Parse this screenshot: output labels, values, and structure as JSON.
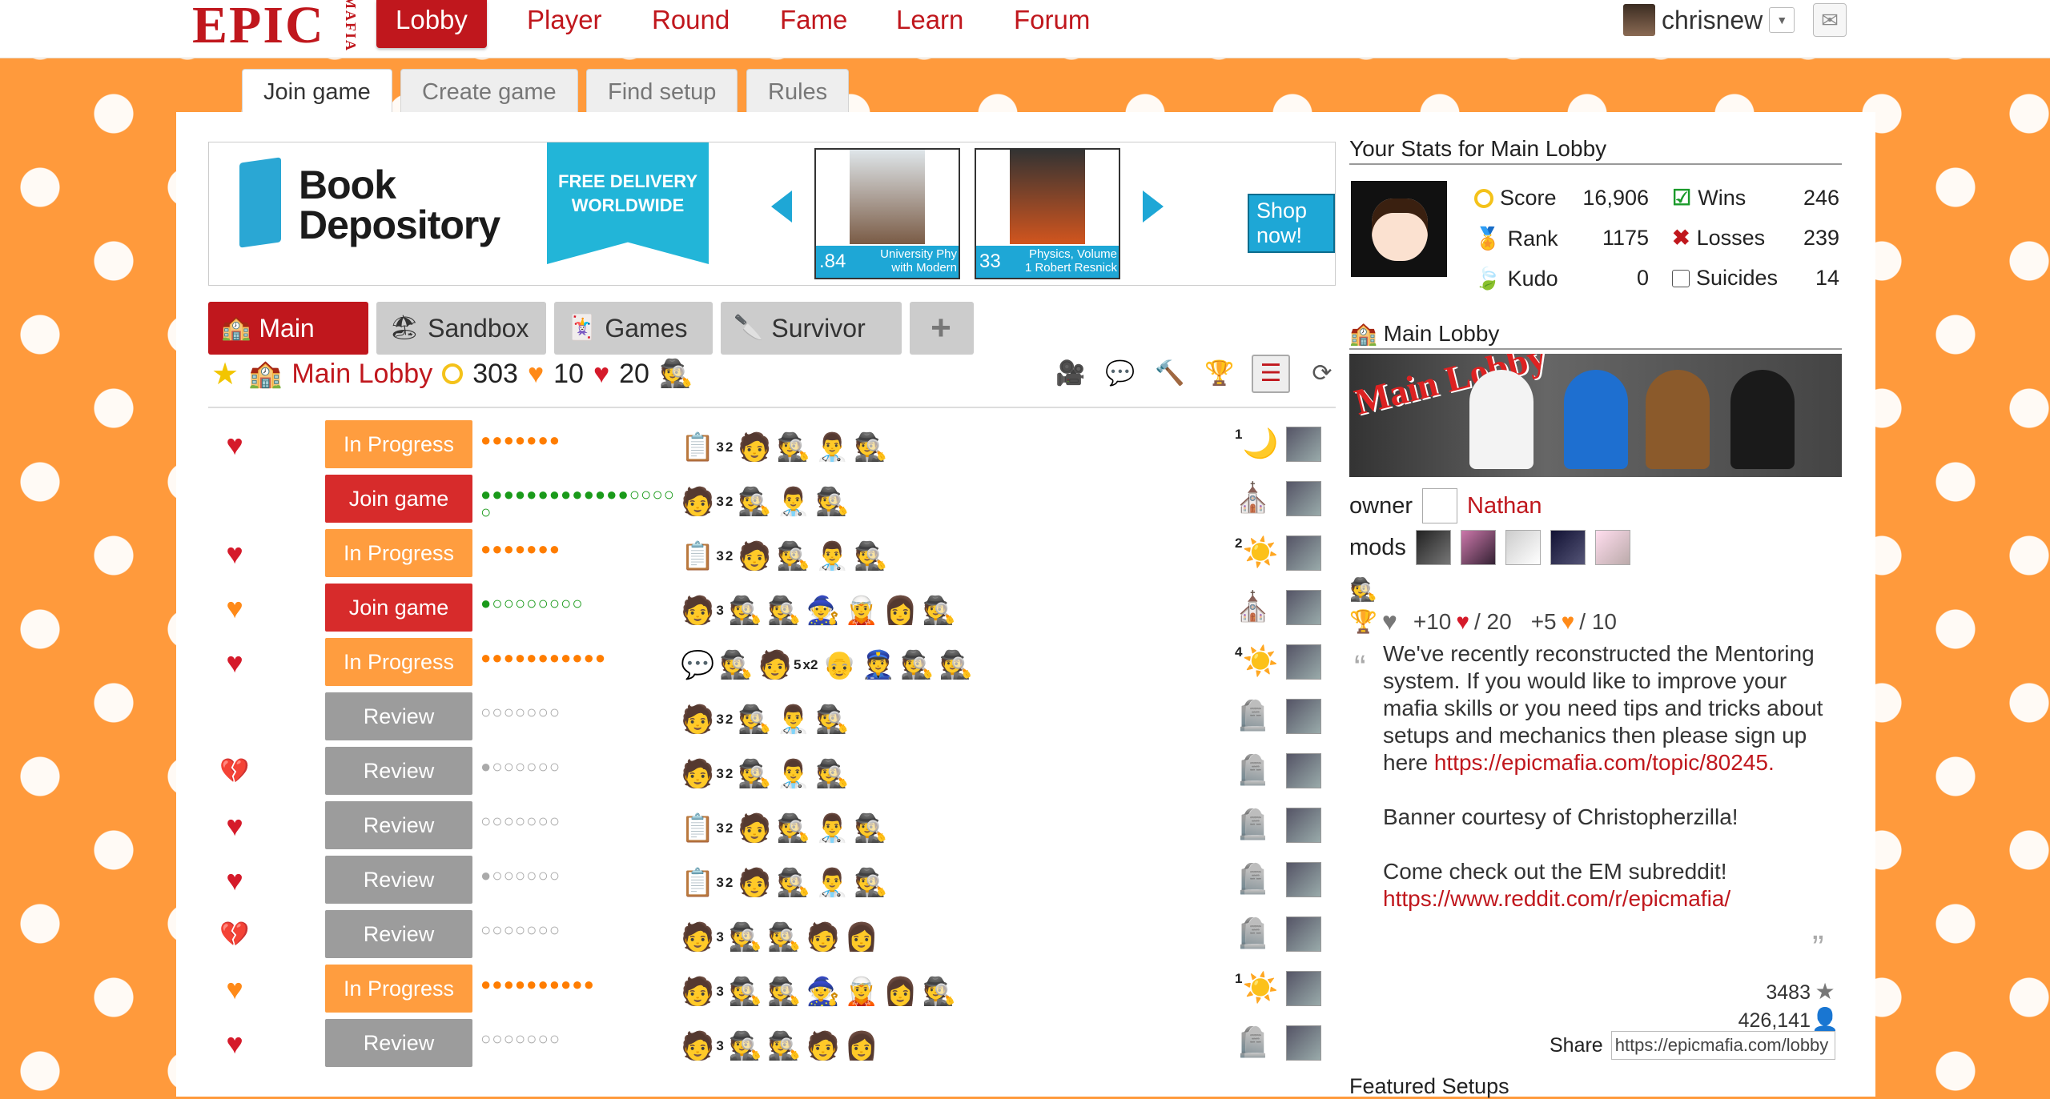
{
  "nav": {
    "logo": "EPIC",
    "logo_small": "MAFIA",
    "links": [
      "Lobby",
      "Player",
      "Round",
      "Fame",
      "Learn",
      "Forum"
    ],
    "username": "chrisnew"
  },
  "subtabs": [
    "Join game",
    "Create game",
    "Find setup",
    "Rules"
  ],
  "ad": {
    "brand_line1": "Book",
    "brand_line2": "Depository",
    "ribbon": "FREE DELIVERY WORLDWIDE",
    "books": [
      {
        "price": ".84",
        "title": "University Phy with Modern"
      },
      {
        "price": "33",
        "title": "Physics, Volume 1 Robert Resnick"
      }
    ],
    "cta": "Shop now!"
  },
  "lobby_tabs": [
    "Main",
    "Sandbox",
    "Games",
    "Survivor",
    "+"
  ],
  "infobar": {
    "lobby_name": "Main Lobby",
    "score": "303",
    "orange_hearts": "10",
    "red_hearts": "20"
  },
  "games": [
    {
      "heart": "red",
      "status": "In Progress",
      "kind": "inprogress",
      "dots": "●●●●●●●",
      "dots_style": "orange",
      "roles": [
        "📋",
        "🧑",
        "🕵️",
        "👨‍⚕️",
        "🕵"
      ],
      "role_counts": [
        "3",
        "2",
        "",
        ""
      ],
      "phase": "🌙",
      "phase_count": "1"
    },
    {
      "heart": "",
      "status": "Join game",
      "kind": "join",
      "dots": "●●●●●●●●●●●●●○○○○○",
      "dots_style": "green",
      "roles": [
        "🧑",
        "🕵️",
        "👨‍⚕️",
        "🕵"
      ],
      "role_counts": [
        "3",
        "2",
        "",
        ""
      ],
      "phase": "⛪",
      "phase_count": ""
    },
    {
      "heart": "red",
      "status": "In Progress",
      "kind": "inprogress",
      "dots": "●●●●●●●",
      "dots_style": "orange",
      "roles": [
        "📋",
        "🧑",
        "🕵️",
        "👨‍⚕️",
        "🕵"
      ],
      "role_counts": [
        "3",
        "2",
        "",
        ""
      ],
      "phase": "☀️",
      "phase_count": "2"
    },
    {
      "heart": "orange",
      "status": "Join game",
      "kind": "join",
      "dots": "●○○○○○○○○",
      "dots_style": "green",
      "roles": [
        "🧑",
        "🕵️",
        "🕵",
        "🧙",
        "🧝",
        "👩",
        "🕵️"
      ],
      "role_counts": [
        "3",
        "",
        "",
        ""
      ],
      "phase": "⛪",
      "phase_count": ""
    },
    {
      "heart": "red",
      "status": "In Progress",
      "kind": "inprogress",
      "dots": "●●●●●●●●●●●",
      "dots_style": "orange",
      "roles": [
        "💬",
        "🕵",
        "🧑",
        "👴",
        "👮",
        "🕵",
        "🕵️"
      ],
      "role_counts": [
        "",
        "",
        "5",
        "x2"
      ],
      "phase": "☀️",
      "phase_count": "4"
    },
    {
      "heart": "",
      "status": "Review",
      "kind": "review",
      "dots": "○○○○○○○",
      "dots_style": "gray",
      "roles": [
        "🧑",
        "🕵️",
        "👨‍⚕️",
        "🕵"
      ],
      "role_counts": [
        "3",
        "2",
        "",
        ""
      ],
      "phase": "🪦",
      "phase_count": ""
    },
    {
      "heart": "broken",
      "status": "Review",
      "kind": "review",
      "dots": "●○○○○○○",
      "dots_style": "gray",
      "roles": [
        "🧑",
        "🕵️",
        "👨‍⚕️",
        "🕵"
      ],
      "role_counts": [
        "3",
        "2",
        "",
        ""
      ],
      "phase": "🪦",
      "phase_count": ""
    },
    {
      "heart": "red",
      "status": "Review",
      "kind": "review",
      "dots": "○○○○○○○",
      "dots_style": "gray",
      "roles": [
        "📋",
        "🧑",
        "🕵️",
        "👨‍⚕️",
        "🕵"
      ],
      "role_counts": [
        "3",
        "2",
        "",
        ""
      ],
      "phase": "🪦",
      "phase_count": ""
    },
    {
      "heart": "red",
      "status": "Review",
      "kind": "review",
      "dots": "●○○○○○○",
      "dots_style": "gray",
      "roles": [
        "📋",
        "🧑",
        "🕵️",
        "👨‍⚕️",
        "🕵"
      ],
      "role_counts": [
        "3",
        "2",
        "",
        ""
      ],
      "phase": "🪦",
      "phase_count": ""
    },
    {
      "heart": "broken",
      "status": "Review",
      "kind": "review",
      "dots": "○○○○○○○",
      "dots_style": "gray",
      "roles": [
        "🧑",
        "🕵️",
        "🕵",
        "🧑",
        "👩"
      ],
      "role_counts": [
        "3",
        "",
        "",
        ""
      ],
      "phase": "🪦",
      "phase_count": ""
    },
    {
      "heart": "orange",
      "status": "In Progress",
      "kind": "inprogress",
      "dots": "●●●●●●●●●●",
      "dots_style": "orange",
      "roles": [
        "🧑",
        "🕵️",
        "🕵",
        "🧙",
        "🧝",
        "👩",
        "🕵️"
      ],
      "role_counts": [
        "3",
        "",
        "",
        ""
      ],
      "phase": "☀️",
      "phase_count": "1"
    },
    {
      "heart": "red",
      "status": "Review",
      "kind": "review",
      "dots": "○○○○○○○",
      "dots_style": "gray",
      "roles": [
        "🧑",
        "🕵️",
        "🕵",
        "🧑",
        "👩"
      ],
      "role_counts": [
        "3",
        "",
        "",
        ""
      ],
      "phase": "🪦",
      "phase_count": ""
    }
  ],
  "stats": {
    "heading": "Your Stats for Main Lobby",
    "score_label": "Score",
    "score": "16,906",
    "rank_label": "Rank",
    "rank": "1175",
    "kudo_label": "Kudo",
    "kudo": "0",
    "wins_label": "Wins",
    "wins": "246",
    "losses_label": "Losses",
    "losses": "239",
    "suicides_label": "Suicides",
    "suicides": "14"
  },
  "lobby_info": {
    "heading": "Main Lobby",
    "banner_text": "Main Lobby",
    "owner_label": "owner",
    "owner": "Nathan",
    "mods_label": "mods",
    "kudos": {
      "red_plus": "+10",
      "red_max": "/ 20",
      "orange_plus": "+5",
      "orange_max": "/ 10"
    },
    "desc": [
      "We've recently reconstructed the Mentoring system. If you would like to improve your mafia skills or you need tips and tricks about setups and mechanics then please sign up here",
      "https://epicmafia.com/topic/80245.",
      "Banner courtesy of Christopherzilla!",
      "Come check out the EM subreddit!",
      "https://www.reddit.com/r/epicmafia/"
    ],
    "stars": "3483",
    "members": "426,141",
    "share_label": "Share",
    "share_url": "https://epicmafia.com/lobby",
    "featured": "Featured Setups"
  },
  "colors": {
    "brand": "#c0171d",
    "orange": "#ff9d3f",
    "join": "#d72b2b",
    "review": "#9c9c9c"
  }
}
